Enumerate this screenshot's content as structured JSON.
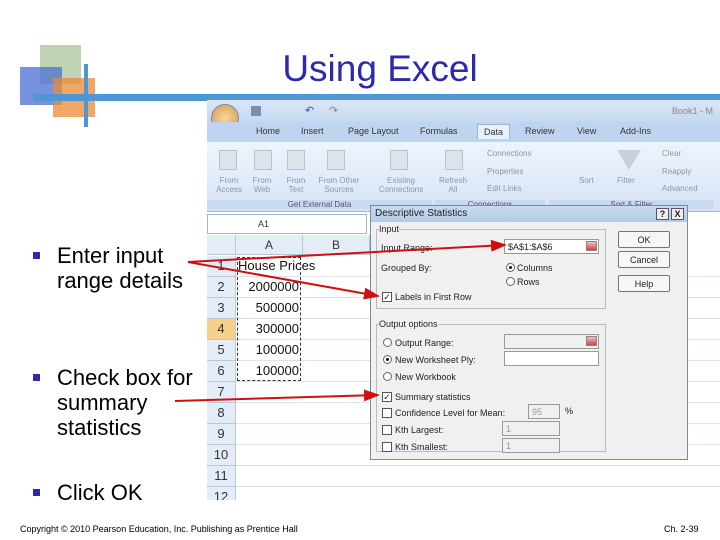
{
  "slide": {
    "title": "Using Excel",
    "bullets": [
      "Enter input range details",
      "Check box for summary statistics",
      "Click OK"
    ],
    "footer_left": "Copyright © 2010 Pearson Education, Inc. Publishing as Prentice Hall",
    "footer_right": "Ch. 2-39"
  },
  "excel": {
    "window_title": "Book1 - M",
    "tabs": [
      "Home",
      "Insert",
      "Page Layout",
      "Formulas",
      "Data",
      "Review",
      "View",
      "Add-Ins"
    ],
    "active_tab": "Data",
    "ribbon": {
      "from_access": "From Access",
      "from_web": "From Web",
      "from_text": "From Text",
      "from_other": "From Other Sources",
      "existing": "Existing Connections",
      "group_external": "Get External Data",
      "refresh": "Refresh All",
      "connections": "Connections",
      "properties": "Properties",
      "edit_links": "Edit Links",
      "group_connections": "Connections",
      "sort": "Sort",
      "filter": "Filter",
      "clear": "Clear",
      "reapply": "Reapply",
      "advanced": "Advanced",
      "group_sort": "Sort & Filter"
    },
    "name_box": "A1",
    "columns": [
      "A",
      "B"
    ],
    "rows": [
      "1",
      "2",
      "3",
      "4",
      "5",
      "6",
      "7",
      "8",
      "9",
      "10",
      "11",
      "12"
    ],
    "cells": [
      "House Prices",
      "2000000",
      "500000",
      "300000",
      "100000",
      "100000"
    ]
  },
  "dialog": {
    "title": "Descriptive Statistics",
    "help": "?",
    "close": "X",
    "input_legend": "Input",
    "input_range_label": "Input Range:",
    "input_range_value": "$A$1:$A$6",
    "grouped_by_label": "Grouped By:",
    "columns_label": "Columns",
    "rows_label": "Rows",
    "labels_first_row": "Labels in First Row",
    "output_legend": "Output options",
    "output_range": "Output Range:",
    "new_worksheet": "New Worksheet Ply:",
    "new_workbook": "New Workbook",
    "summary_stats": "Summary statistics",
    "confidence": "Confidence Level for Mean:",
    "confidence_value": "95",
    "percent": "%",
    "kth_largest": "Kth Largest:",
    "kth_largest_value": "1",
    "kth_smallest": "Kth Smallest:",
    "kth_smallest_value": "1",
    "ok": "OK",
    "cancel": "Cancel",
    "help_btn": "Help"
  },
  "colors": {
    "title": "#2a2ab0",
    "arrow": "#d01010",
    "accent_line": "#4f97d2"
  }
}
